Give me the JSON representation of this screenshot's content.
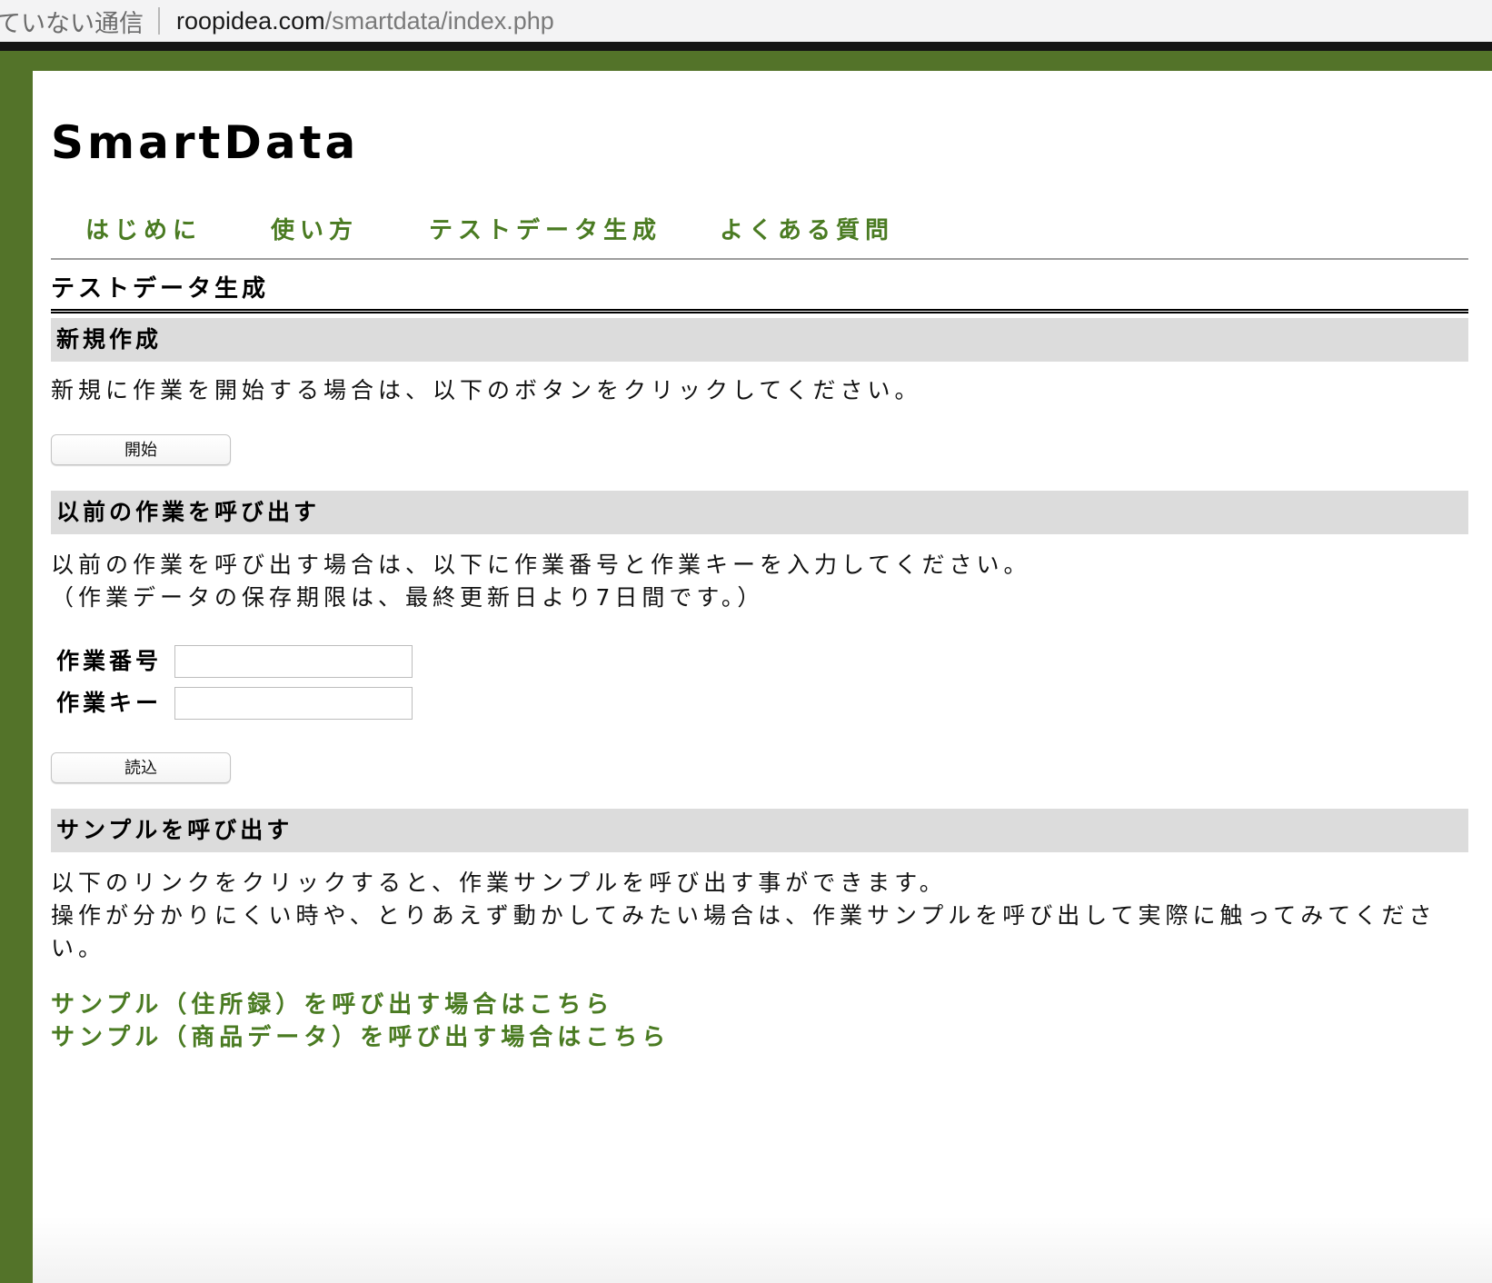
{
  "browser": {
    "security_text": "ていない通信",
    "url_host": "roopidea.com",
    "url_path": "/smartdata/index.php"
  },
  "site": {
    "title": "SmartData"
  },
  "nav": {
    "items": [
      {
        "label": "はじめに"
      },
      {
        "label": "使い方"
      },
      {
        "label": "テストデータ生成"
      },
      {
        "label": "よくある質問"
      }
    ]
  },
  "page": {
    "heading": "テストデータ生成"
  },
  "new_section": {
    "heading": "新規作成",
    "text": "新規に作業を開始する場合は、以下のボタンをクリックしてください。",
    "button_label": "開始"
  },
  "load_section": {
    "heading": "以前の作業を呼び出す",
    "text_line1": "以前の作業を呼び出す場合は、以下に作業番号と作業キーを入力してください。",
    "text_line2": "（作業データの保存期限は、最終更新日より7日間です。）",
    "work_number_label": "作業番号",
    "work_number_value": "",
    "work_key_label": "作業キー",
    "work_key_value": "",
    "button_label": "読込"
  },
  "sample_section": {
    "heading": "サンプルを呼び出す",
    "text_line1": "以下のリンクをクリックすると、作業サンプルを呼び出す事ができます。",
    "text_line2": "操作が分かりにくい時や、とりあえず動かしてみたい場合は、作業サンプルを呼び出して実際に触ってみてください。",
    "links": [
      {
        "label": "サンプル（住所録）を呼び出す場合はこちら"
      },
      {
        "label": "サンプル（商品データ）を呼び出す場合はこちら"
      }
    ]
  },
  "colors": {
    "frame_green": "#537329",
    "link_green": "#4a7b22",
    "section_gray": "#dcdcdc"
  }
}
